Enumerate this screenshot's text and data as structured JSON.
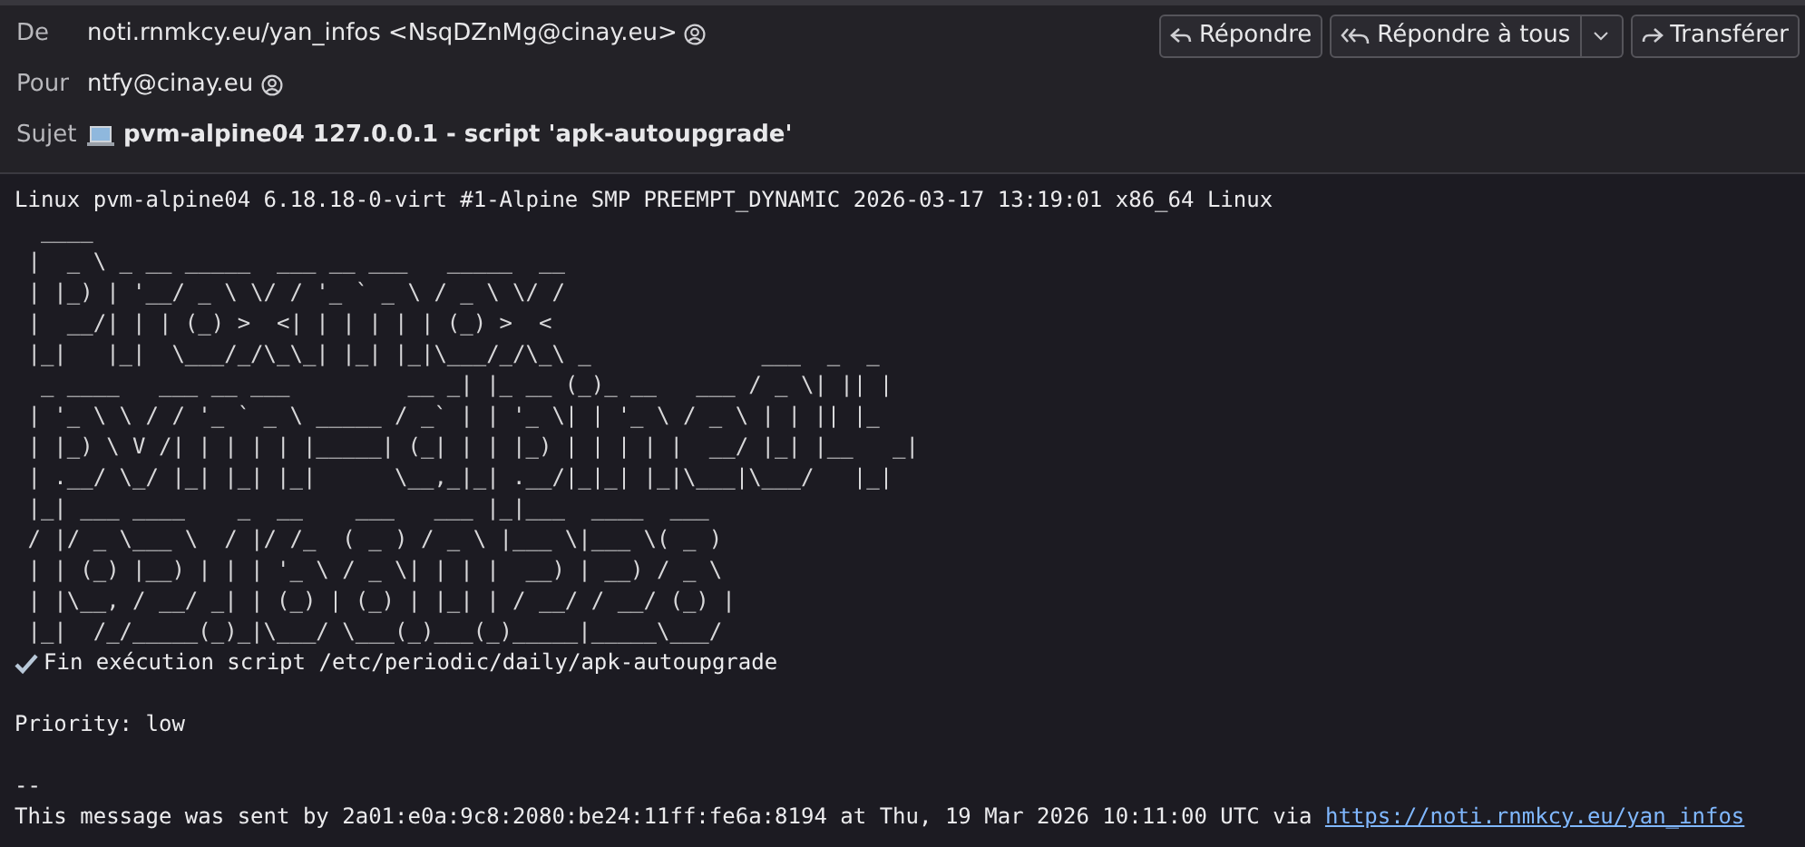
{
  "header": {
    "fields": [
      {
        "label": "De",
        "value": "noti.rnmkcy.eu/yan_infos <NsqDZnMg@cinay.eu>",
        "contact_icon": true
      },
      {
        "label": "Pour",
        "value": "ntfy@cinay.eu",
        "contact_icon": true
      }
    ],
    "subject": {
      "label": "Sujet",
      "value": "pvm-alpine04 127.0.0.1 - script 'apk-autoupgrade'"
    },
    "buttons": [
      {
        "kind": "reply",
        "label": "Répondre"
      },
      {
        "kind": "reply_all",
        "label": "Répondre à tous"
      },
      {
        "kind": "forward",
        "label": "Transférer"
      }
    ]
  },
  "body": {
    "uname": "Linux pvm-alpine04 6.18.18-0-virt #1-Alpine SMP PREEMPT_DYNAMIC 2026-03-17 13:19:01 x86_64 Linux",
    "art_lines": [
      "  ____",
      " |  _ \\ _ __ _____  ___ __ ___   _____  __",
      " | |_) | '__/ _ \\ \\/ / '_ ` _ \\ / _ \\ \\/ /",
      " |  __/| | | (_) >  <| | | | | | (_) >  <",
      " |_|   |_|  \\___/_/\\_\\_| |_| |_|\\___/_/\\_\\ _             ___  _  _",
      "  _ ____   ___ __ ___         __ _| |_ __ (_)_ __   ___ / _ \\| || |",
      " | '_ \\ \\ / / '_ ` _ \\ _____ / _` | | '_ \\| | '_ \\ / _ \\ | | || |_",
      " | |_) \\ V /| | | | | |_____| (_| | | |_) | | | | |  __/ |_| |__   _|",
      " | .__/ \\_/ |_| |_| |_|      \\__,_|_| .__/|_|_| |_|\\___|\\___/   |_|",
      " |_| ___ ____    _  __    ___   ___ |_|___  ____  ___",
      " / |/ _ \\___ \\  / |/ /_  ( _ ) / _ \\ |___ \\|___ \\( _ )",
      " | | (_) |__) | | | '_ \\ / _ \\| | | |  __) | __) / _ \\",
      " | |\\__, / __/ _| | (_) | (_) | |_| | / __/ / __/ (_) |",
      " |_|  /_/_____(_)_|\\___/ \\___(_)___(_)_____|_____\\___/"
    ],
    "status": {
      "done": true,
      "text": "Fin exécution script /etc/periodic/daily/apk-autoupgrade"
    },
    "priority": "Priority: low",
    "signature_separator": "--",
    "footer": "This message was sent by 2a01:e0a:9c8:2080:be24:11ff:fe6a:8194 at Thu, 19 Mar 2026 10:11:00 UTC via ",
    "footer_link": "https://noti.rnmkcy.eu/yan_infos"
  }
}
